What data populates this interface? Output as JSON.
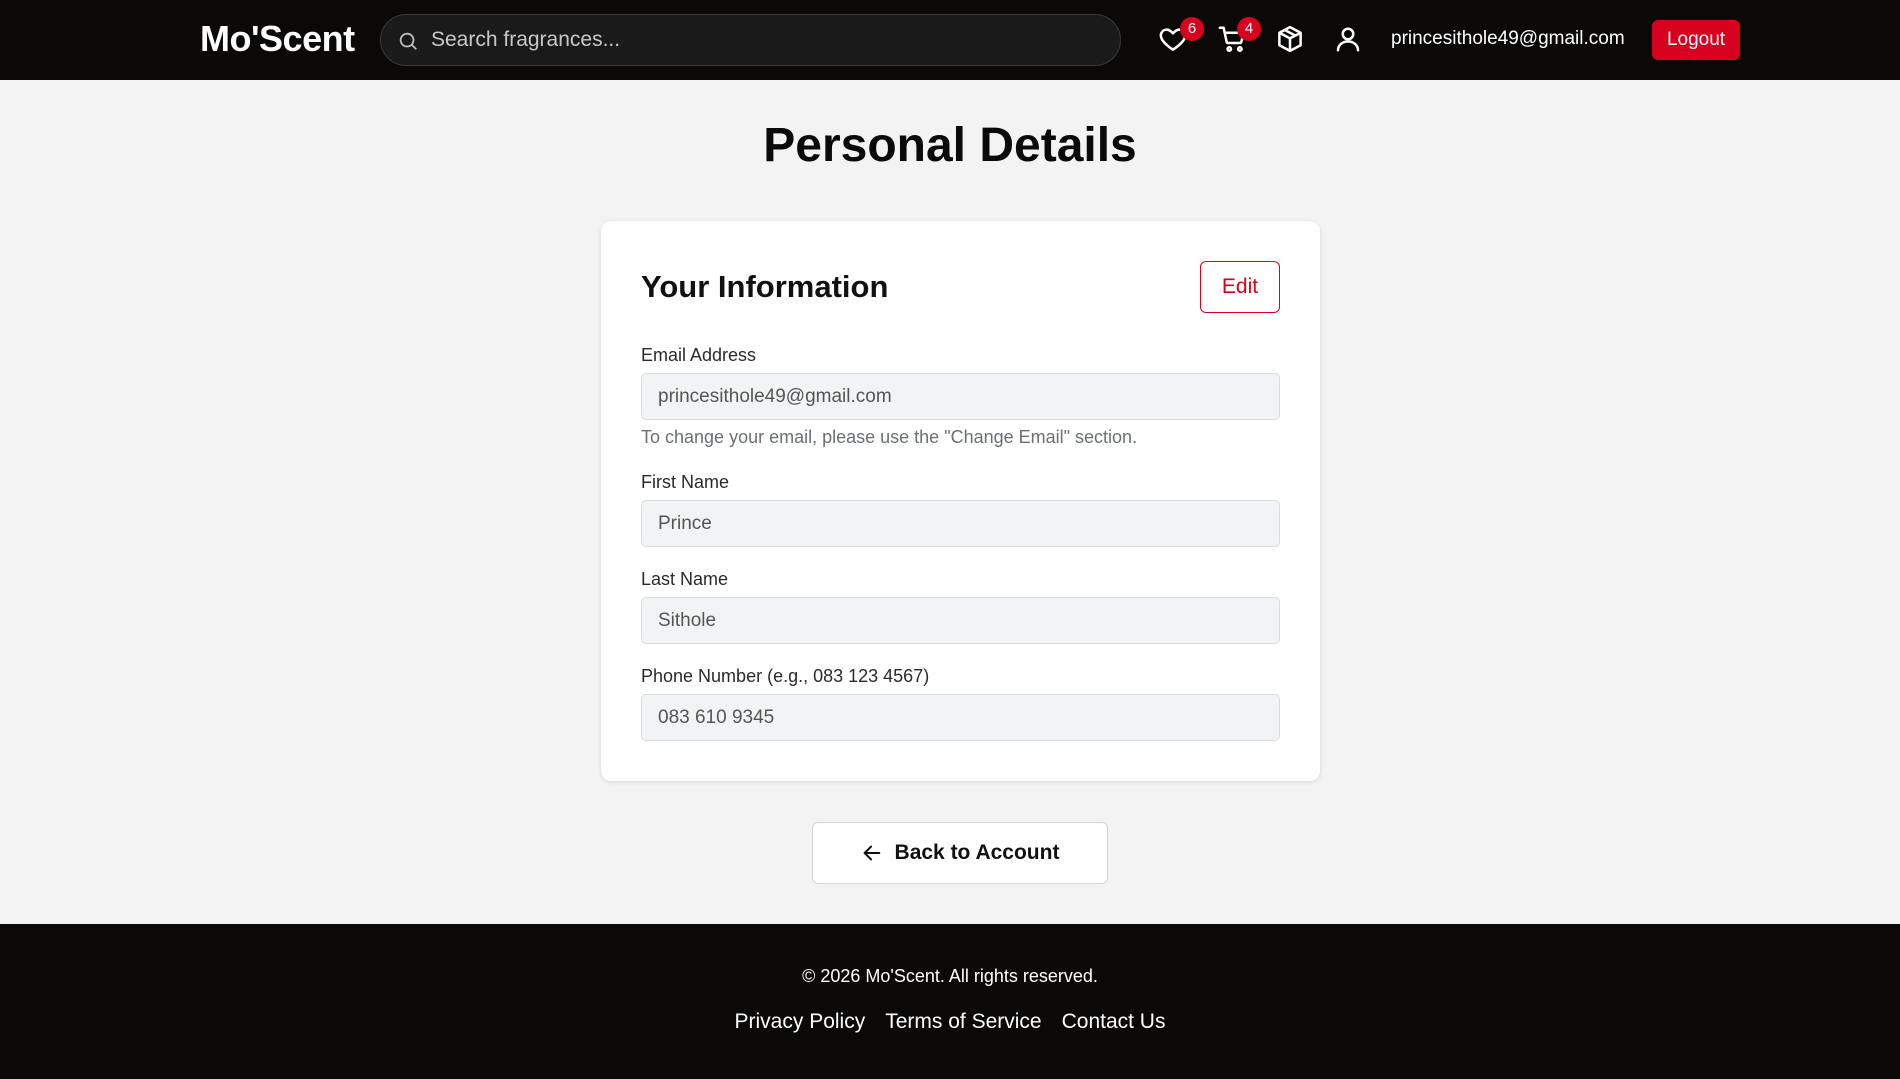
{
  "header": {
    "logo": "Mo'Scent",
    "search_placeholder": "Search fragrances...",
    "wishlist_count": "6",
    "cart_count": "4",
    "user_email": "princesithole49@gmail.com",
    "logout_label": "Logout"
  },
  "main": {
    "page_title": "Personal Details",
    "card_title": "Your Information",
    "edit_label": "Edit",
    "fields": {
      "email": {
        "label": "Email Address",
        "value": "princesithole49@gmail.com",
        "hint": "To change your email, please use the \"Change Email\" section."
      },
      "first_name": {
        "label": "First Name",
        "value": "Prince"
      },
      "last_name": {
        "label": "Last Name",
        "value": "Sithole"
      },
      "phone": {
        "label": "Phone Number (e.g., 083 123 4567)",
        "value": "083 610 9345"
      }
    },
    "back_label": "Back to Account"
  },
  "footer": {
    "copyright": "© 2026 Mo'Scent. All rights reserved.",
    "links": [
      "Privacy Policy",
      "Terms of Service",
      "Contact Us"
    ]
  },
  "colors": {
    "accent": "#d8001f",
    "header_bg": "#0a0908",
    "page_bg": "#f2f3f2"
  },
  "icons": [
    "search-icon",
    "heart-icon",
    "cart-icon",
    "package-icon",
    "user-icon",
    "arrow-left-icon"
  ]
}
